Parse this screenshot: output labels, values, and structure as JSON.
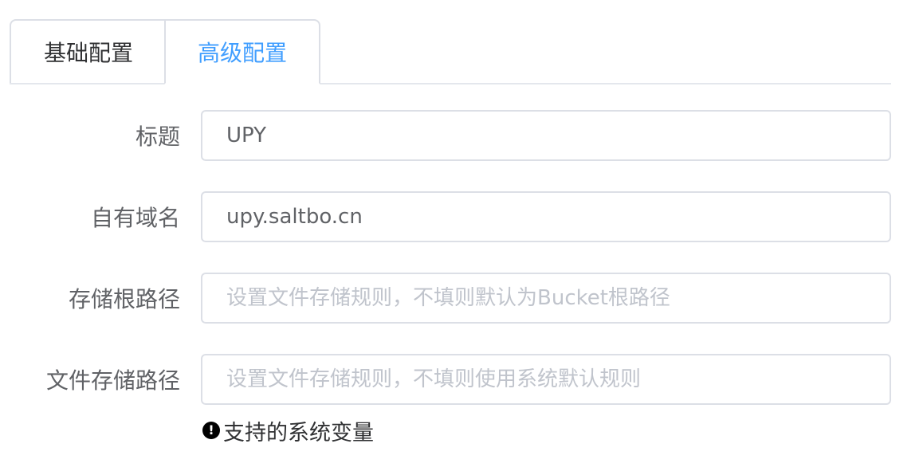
{
  "tabs": [
    {
      "label": "基础配置"
    },
    {
      "label": "高级配置"
    }
  ],
  "fields": {
    "title": {
      "label": "标题",
      "value": "UPY",
      "placeholder": ""
    },
    "custom_domain": {
      "label": "自有域名",
      "value": "upy.saltbo.cn",
      "placeholder": ""
    },
    "storage_root": {
      "label": "存储根路径",
      "value": "",
      "placeholder": "设置文件存储规则，不填则默认为Bucket根路径"
    },
    "file_storage_path": {
      "label": "文件存储路径",
      "value": "",
      "placeholder": "设置文件存储规则，不填则使用系统默认规则"
    }
  },
  "hint": {
    "icon": "exclamation-circle-icon",
    "label": "支持的系统变量"
  },
  "colors": {
    "accent": "#409eff",
    "text": "#606266",
    "border": "#dcdfe6",
    "placeholder": "#c0c4cc"
  }
}
